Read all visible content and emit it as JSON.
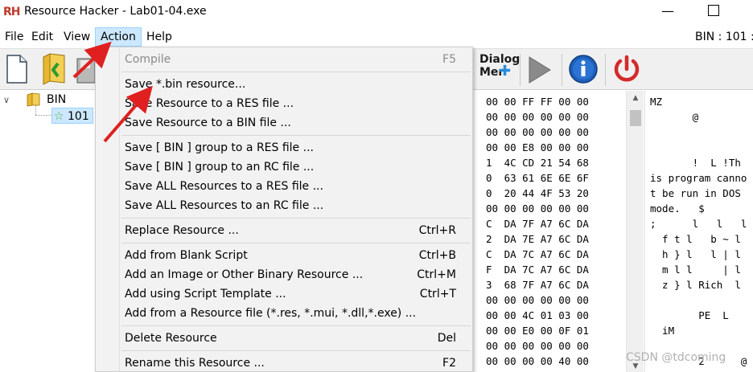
{
  "window": {
    "title": "Resource Hacker - Lab01-04.exe",
    "icon_text": "RH",
    "minimize_glyph": "—"
  },
  "menubar": {
    "items": [
      "File",
      "Edit",
      "View",
      "Action",
      "Help"
    ],
    "active": "Action",
    "right_label": "BIN : 101 :"
  },
  "toolbar": {
    "dialog_menu_label_1": "Dialog",
    "dialog_menu_label_2": "Mer"
  },
  "tree": {
    "root_label": "BIN",
    "child_label": "101",
    "expander_glyph": "∨"
  },
  "action_menu": {
    "items": [
      {
        "label": "Compile",
        "shortcut": "F5",
        "disabled": true
      },
      {
        "label": "Save *.bin resource...",
        "shortcut": ""
      },
      {
        "label": "Save Resource to a RES file ...",
        "shortcut": ""
      },
      {
        "label": "Save Resource to a BIN file ...",
        "shortcut": ""
      },
      {
        "label": "Save [ BIN ] group to a RES file ...",
        "shortcut": ""
      },
      {
        "label": "Save [ BIN ] group to an RC file ...",
        "shortcut": ""
      },
      {
        "label": "Save ALL Resources to a RES file ...",
        "shortcut": ""
      },
      {
        "label": "Save ALL Resources to an RC file ...",
        "shortcut": ""
      },
      {
        "label": "Replace Resource ...",
        "shortcut": "Ctrl+R"
      },
      {
        "label": "Add from Blank Script",
        "shortcut": "Ctrl+B"
      },
      {
        "label": "Add an Image or Other Binary Resource ...",
        "shortcut": "Ctrl+M"
      },
      {
        "label": "Add using Script Template ...",
        "shortcut": "Ctrl+T"
      },
      {
        "label": "Add from a Resource file (*.res, *.mui, *.dll,*.exe) ...",
        "shortcut": ""
      },
      {
        "label": "Delete Resource",
        "shortcut": "Del"
      },
      {
        "label": "Rename this Resource ...",
        "shortcut": "F2"
      }
    ]
  },
  "hex_lines": [
    "00 00 FF FF 00 00",
    "00 00 00 00 00 00",
    "00 00 00 00 00 00",
    "00 00 E8 00 00 00",
    "1  4C CD 21 54 68",
    "0  63 61 6E 6E 6F",
    "0  20 44 4F 53 20",
    "00 00 00 00 00 00",
    "C  DA 7F A7 6C DA",
    "2  DA 7E A7 6C DA",
    "C  DA 7C A7 6C DA",
    "F  DA 7C A7 6C DA",
    "3  68 7F A7 6C DA",
    "00 00 00 00 00 00",
    "00 00 4C 01 03 00",
    "00 00 E0 00 0F 01",
    "00 00 00 00 00 00",
    "00 00 00 00 40 00"
  ],
  "ascii_lines": [
    "MZ",
    "       @",
    "",
    "",
    "       !  L !Th",
    "is program canno",
    "t be run in DOS",
    "mode.   $",
    ";      l   l   l",
    "  f t l   b ~ l",
    "  h } l   l | l",
    "  m l l     | l",
    "  z } l Rich  l",
    "",
    "        PE  L",
    "  iM",
    "",
    "        2      @"
  ],
  "watermark": "CSDN @tdcoming"
}
